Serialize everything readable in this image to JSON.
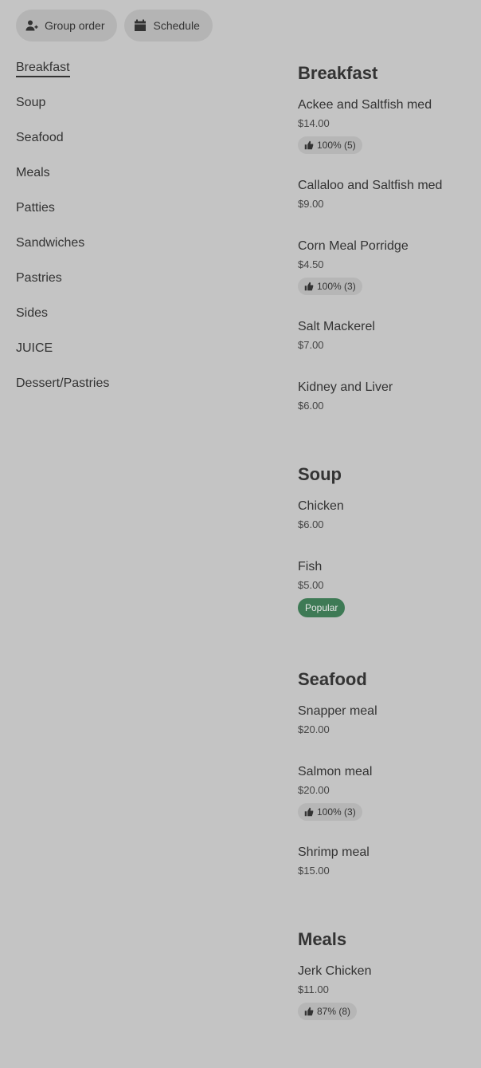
{
  "top_actions": {
    "group_order_label": "Group order",
    "schedule_label": "Schedule"
  },
  "nav": {
    "active": "Breakfast",
    "items": [
      "Breakfast",
      "Soup",
      "Seafood",
      "Meals",
      "Patties",
      "Sandwiches",
      "Pastries",
      "Sides",
      "JUICE",
      "Dessert/Pastries"
    ]
  },
  "sections": [
    {
      "title": "Breakfast",
      "items": [
        {
          "name": "Ackee and Saltfish med",
          "price": "$14.00",
          "rating": "100% (5)"
        },
        {
          "name": "Callaloo and Saltfish med",
          "price": "$9.00"
        },
        {
          "name": "Corn Meal Porridge",
          "price": "$4.50",
          "rating": "100% (3)"
        },
        {
          "name": "Salt Mackerel",
          "price": "$7.00"
        },
        {
          "name": "Kidney and Liver",
          "price": "$6.00"
        }
      ]
    },
    {
      "title": "Soup",
      "items": [
        {
          "name": "Chicken",
          "price": "$6.00"
        },
        {
          "name": "Fish",
          "price": "$5.00",
          "badge": "Popular"
        }
      ]
    },
    {
      "title": "Seafood",
      "items": [
        {
          "name": "Snapper meal",
          "price": "$20.00"
        },
        {
          "name": "Salmon meal",
          "price": "$20.00",
          "rating": "100% (3)"
        },
        {
          "name": "Shrimp meal",
          "price": "$15.00"
        }
      ]
    },
    {
      "title": "Meals",
      "items": [
        {
          "name": "Jerk Chicken",
          "price": "$11.00",
          "rating": "87% (8)"
        }
      ]
    }
  ]
}
